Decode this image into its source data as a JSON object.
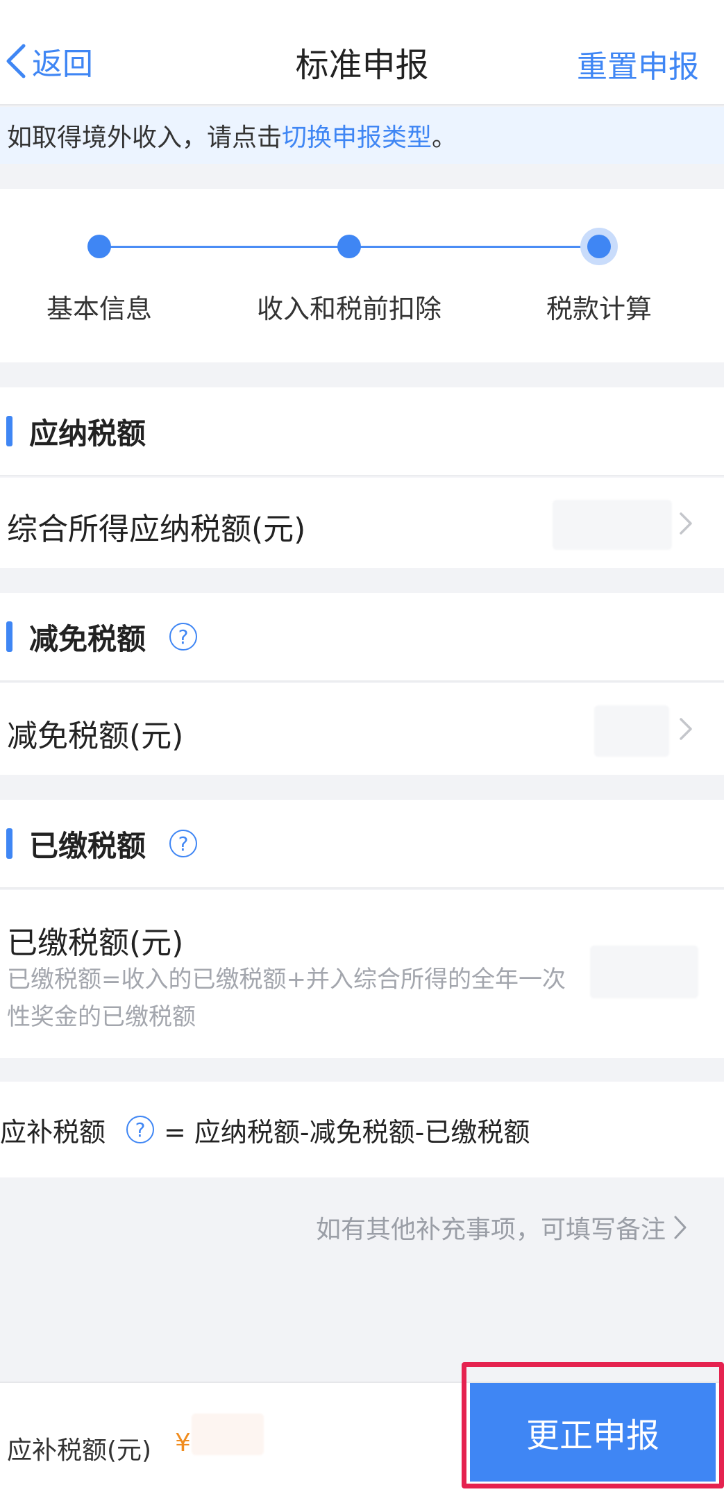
{
  "nav": {
    "back_label": "返回",
    "title": "标准申报",
    "reset_label": "重置申报"
  },
  "notice": {
    "text_before": "如取得境外收入，请点击",
    "link_text": "切换申报类型",
    "text_after": "。"
  },
  "steps": [
    {
      "label": "基本信息",
      "state": "done"
    },
    {
      "label": "收入和税前扣除",
      "state": "done"
    },
    {
      "label": "税款计算",
      "state": "current"
    }
  ],
  "sections": {
    "payable": {
      "title": "应纳税额",
      "row_label": "综合所得应纳税额(元)"
    },
    "reduction": {
      "title": "减免税额",
      "row_label": "减免税额(元)"
    },
    "paid": {
      "title": "已缴税额",
      "row_label": "已缴税额(元)",
      "row_desc": "已缴税额=收入的已缴税额+并入综合所得的全年一次性奖金的已缴税额"
    }
  },
  "formula": {
    "label": "应补税额",
    "expression": "= 应纳税额-减免税额-已缴税额"
  },
  "remark": {
    "text": "如有其他补充事项，可填写备注"
  },
  "bottom": {
    "label": "应补税额(元)",
    "currency": "¥",
    "submit_label": "更正申报"
  },
  "colors": {
    "accent": "#3f86f4",
    "highlight_outline": "#e5224f",
    "currency": "#f08c1e"
  }
}
